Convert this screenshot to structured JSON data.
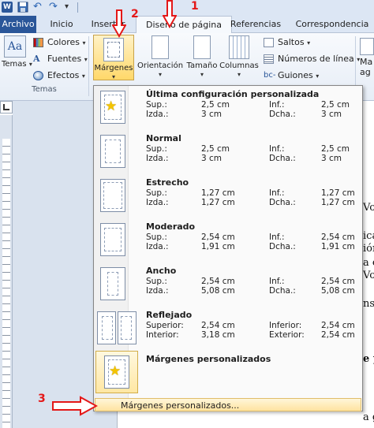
{
  "quick_access": {
    "app_icon_letter": "W"
  },
  "tabs": [
    {
      "label": "Archivo"
    },
    {
      "label": "Inicio"
    },
    {
      "label": "Insertar"
    },
    {
      "label": "Diseño de página"
    },
    {
      "label": "Referencias"
    },
    {
      "label": "Correspondencia"
    }
  ],
  "ribbon": {
    "temas": {
      "big_label": "Temas",
      "colores": "Colores",
      "fuentes": "Fuentes",
      "efectos": "Efectos",
      "group_label": "Temas",
      "icon_text": "Aa"
    },
    "page_setup": {
      "margenes": "Márgenes",
      "orientacion": "Orientación",
      "tamano": "Tamaño",
      "columnas": "Columnas",
      "saltos": "Saltos",
      "numeros_linea": "Números de línea",
      "guiones": "Guiones"
    },
    "more_label_1": "Ma",
    "more_label_2": "ag"
  },
  "menu": {
    "items": [
      {
        "title": "Última configuración personalizada",
        "l1": "Sup.:",
        "v1": "2,5 cm",
        "l2": "Inf.:",
        "v2": "2,5 cm",
        "l3": "Izda.:",
        "v3": "3 cm",
        "l4": "Dcha.:",
        "v4": "3 cm"
      },
      {
        "title": "Normal",
        "l1": "Sup.:",
        "v1": "2,5 cm",
        "l2": "Inf.:",
        "v2": "2,5 cm",
        "l3": "Izda.:",
        "v3": "3 cm",
        "l4": "Dcha.:",
        "v4": "3 cm"
      },
      {
        "title": "Estrecho",
        "l1": "Sup.:",
        "v1": "1,27 cm",
        "l2": "Inf.:",
        "v2": "1,27 cm",
        "l3": "Izda.:",
        "v3": "1,27 cm",
        "l4": "Dcha.:",
        "v4": "1,27 cm"
      },
      {
        "title": "Moderado",
        "l1": "Sup.:",
        "v1": "2,54 cm",
        "l2": "Inf.:",
        "v2": "2,54 cm",
        "l3": "Izda.:",
        "v3": "1,91 cm",
        "l4": "Dcha.:",
        "v4": "1,91 cm"
      },
      {
        "title": "Ancho",
        "l1": "Sup.:",
        "v1": "2,54 cm",
        "l2": "Inf.:",
        "v2": "2,54 cm",
        "l3": "Izda.:",
        "v3": "5,08 cm",
        "l4": "Dcha.:",
        "v4": "5,08 cm"
      },
      {
        "title": "Reflejado",
        "l1": "Superior:",
        "v1": "2,54 cm",
        "l2": "Inferior:",
        "v2": "2,54 cm",
        "l3": "Interior:",
        "v3": "3,18 cm",
        "l4": "Exterior:",
        "v4": "2,54 cm"
      }
    ],
    "custom_title": "Márgenes personalizados",
    "footer": "Márgenes personalizados..."
  },
  "document_fragments": [
    "Vo",
    "ica",
    "ión",
    "a c",
    "Vo",
    "ns c",
    "e p",
    "a g"
  ],
  "annotations": {
    "one": "1",
    "two": "2",
    "three": "3"
  },
  "colors": {
    "accent": "#2a5699",
    "highlight": "#ffd86a",
    "annotation": "#e41818"
  }
}
